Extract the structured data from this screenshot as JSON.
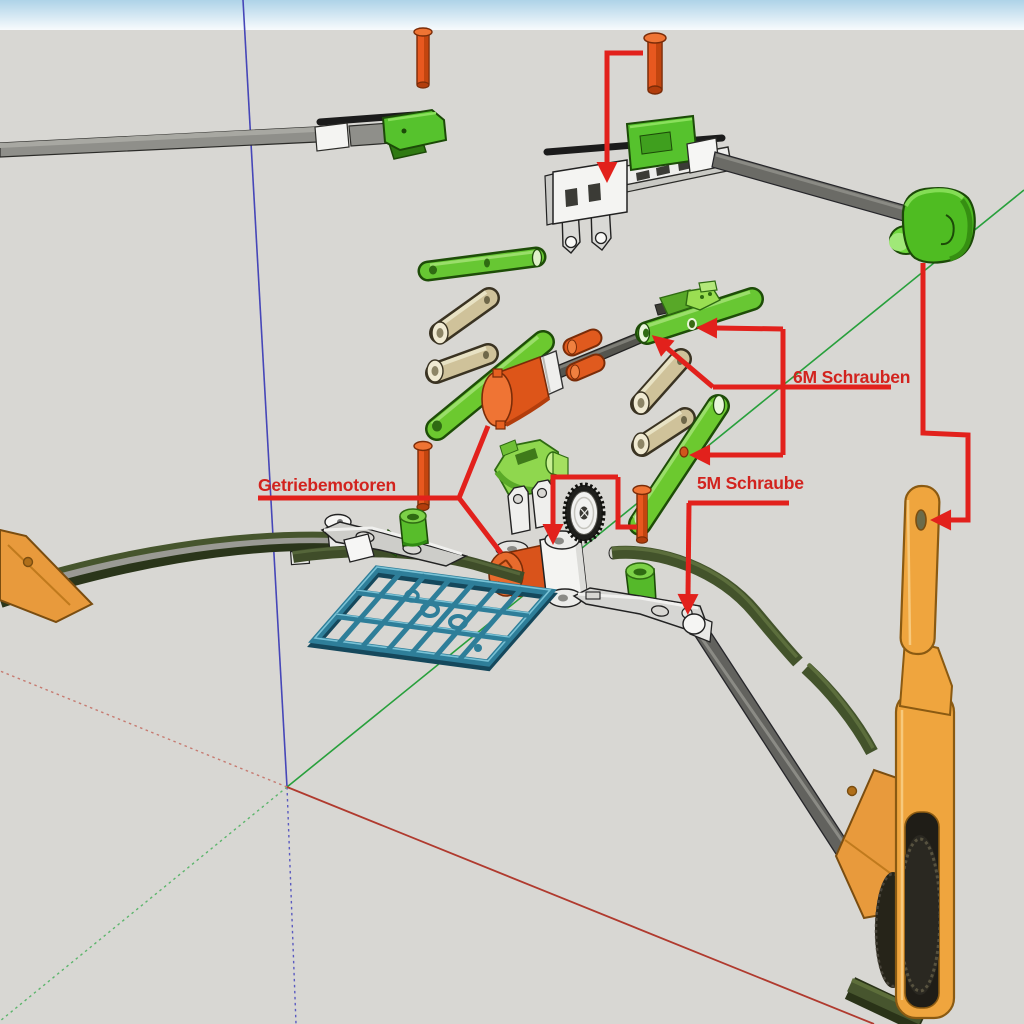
{
  "viewport": {
    "type": "3d-cad-exploded-view",
    "sky_color_top": "#b5d8eb",
    "sky_color_bottom": "#f7fbfd",
    "ground_color": "#d8d7d3"
  },
  "axes": {
    "x_axis_color": "#b03a2e",
    "y_axis_color": "#28a03c",
    "z_axis_color": "#4646b8"
  },
  "annotations": {
    "color": "#e2211c",
    "gear_motors": {
      "label": "Getriebemotoren"
    },
    "screws_6m": {
      "label": "6M Schrauben"
    },
    "screw_5m": {
      "label": "5M Schraube"
    }
  },
  "palette": {
    "screw_orange": "#e8581f",
    "motor_orange": "#dd5519",
    "swing_arm_orange": "#efa53e",
    "link_green": "#66c732",
    "block_green": "#4fbc22",
    "servo_lime": "#9ade52",
    "roller_tan": "#cfc39a",
    "chassis_teal": "#2e7e99",
    "track_green": "#44522c",
    "rod_gray": "#6a6a65",
    "bracket_white": "#f4f4f4"
  },
  "parts_inventory": [
    "left-wheel-arm-rod",
    "top-screw",
    "small-screw-left",
    "top-lever-assembly",
    "right-rod",
    "green-end-block",
    "green-link-bar-top",
    "tan-roller-1",
    "tan-roller-2",
    "tan-roller-3",
    "tan-roller-4",
    "gear-motor-upper",
    "shaft-coupler-1",
    "shaft-coupler-2",
    "green-link-bar-6m",
    "servo-horn-bracket",
    "green-link-bar-5m",
    "mid-screw-left",
    "gear-screw",
    "micro-servo",
    "gear-wheel",
    "gear-motor-lower",
    "motor-bracket",
    "chassis-plate",
    "left-steering-arm",
    "left-knuckle",
    "left-track-arc",
    "left-pivot-plate",
    "joint-knob-left",
    "right-steering-arm",
    "right-knuckle",
    "right-joint-cylinder",
    "drive-rod",
    "right-track-arc-upper",
    "right-track-arc-lower",
    "swing-arm",
    "pivot-plate-right",
    "tread-wheel",
    "bottom-track-segment"
  ]
}
